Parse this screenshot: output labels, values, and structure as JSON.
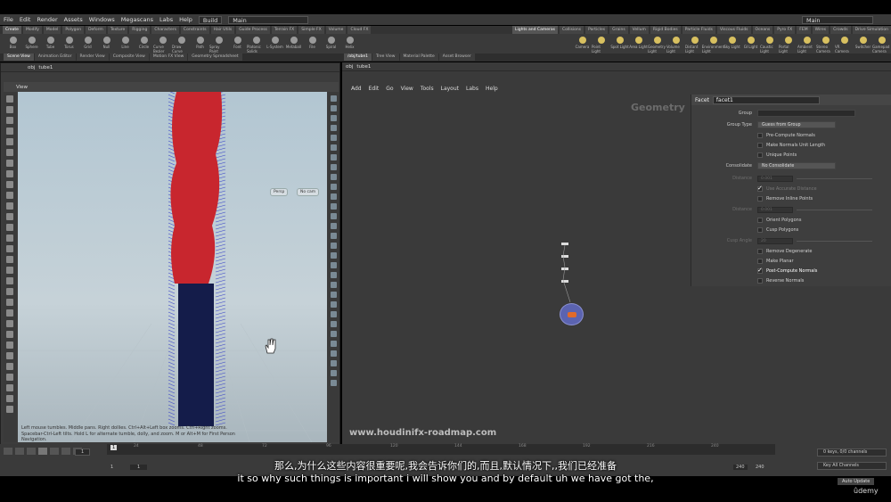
{
  "menubar": {
    "items": [
      "File",
      "Edit",
      "Render",
      "Assets",
      "Windows",
      "Megascans",
      "Labs",
      "Help"
    ],
    "desktop": "Build",
    "context": "Main",
    "right_context": "Main"
  },
  "shelf": {
    "tabs": [
      "Create",
      "Modify",
      "Model",
      "Polygon",
      "Deform",
      "Texture",
      "Rigging",
      "Characters",
      "Constraints",
      "Hair Utils",
      "Guide Process",
      "Terrain FX",
      "Simple FX",
      "Volume",
      "Cloud FX"
    ],
    "tools": [
      "Box",
      "Sphere",
      "Tube",
      "Torus",
      "Grid",
      "Null",
      "Line",
      "Circle",
      "Curve Bezier",
      "Draw Curve",
      "Path",
      "Spray Paint",
      "Font",
      "Platonic Solids",
      "L-System",
      "Metaball",
      "File",
      "Spiral",
      "Helix"
    ],
    "right_tabs": [
      "Lights and Cameras",
      "Collisions",
      "Particles",
      "Grains",
      "Vellum",
      "Rigid Bodies",
      "Particle Fluids",
      "Viscous Fluids",
      "Oceans",
      "Pyro FX",
      "FEM",
      "Wires",
      "Crowds",
      "Drive Simulation"
    ],
    "right_tools": [
      "Camera",
      "Point Light",
      "Spot Light",
      "Area Light",
      "Geometry Light",
      "Volume Light",
      "Distant Light",
      "Environment Light",
      "Sky Light",
      "GI Light",
      "Caustic Light",
      "Portal Light",
      "Ambient Light",
      "Stereo Camera",
      "VR Camera",
      "Switcher",
      "Gamepad Camera"
    ]
  },
  "left_pane": {
    "tabs": [
      "Scene View",
      "Animation Editor",
      "Render View",
      "Composite View",
      "Motion FX View",
      "Geometry Spreadsheet"
    ],
    "path": [
      "obj",
      "tube1"
    ],
    "view_label": "View",
    "persp": "Persp",
    "cam": "No cam",
    "hint": "Left mouse tumbles. Middle pans. Right dollies. Ctrl+Alt+Left box zooms. Ctrl+Right zooms. Spacebar-Ctrl-Left tilts. Hold L for alternate tumble, dolly, and zoom.    M or Alt+M for First Person Navigation."
  },
  "right_pane": {
    "tabs": [
      "/obj/tube1",
      "Tree View",
      "Material Palette",
      "Asset Browser"
    ],
    "path": [
      "obj",
      "tube1"
    ],
    "menu": [
      "Add",
      "Edit",
      "Go",
      "View",
      "Tools",
      "Layout",
      "Labs",
      "Help"
    ],
    "context_label": "Geometry",
    "watermark": "www.houdinifx-roadmap.com"
  },
  "params": {
    "node_type": "Facet",
    "node_name": "facet1",
    "group_label": "Group",
    "group_type_label": "Group Type",
    "group_type": "Guess from Group",
    "pre_compute": "Pre-Compute Normals",
    "make_unit": "Make Normals Unit Length",
    "unique": "Unique Points",
    "consolidate_label": "Consolidate",
    "consolidate": "No Consolidate",
    "distance_label": "Distance",
    "distance_val": "0.001",
    "accurate": "Use Accurate Distance",
    "remove_inline": "Remove Inline Points",
    "distance2_label": "Distance",
    "distance2_val": "0.001",
    "orient": "Orient Polygons",
    "cusp_polys": "Cusp Polygons",
    "cusp_angle_label": "Cusp Angle",
    "cusp_angle_val": "20",
    "remove_degen": "Remove Degenerate",
    "make_planar": "Make Planar",
    "post_compute": "Post-Compute Normals",
    "reverse": "Reverse Normals"
  },
  "timeline": {
    "ticks": [
      "1",
      "24",
      "48",
      "72",
      "96",
      "120",
      "144",
      "168",
      "192",
      "216",
      "240"
    ],
    "frame": "1",
    "start": "1",
    "start2": "1",
    "end": "240",
    "end2": "240",
    "keys": "0 keys, 0/0 channels",
    "key_all": "Key All Channels",
    "auto_update": "Auto Update"
  },
  "subtitles": {
    "zh": "那么,为什么这些内容很重要呢,我会告诉你们的,而且,默认情况下,,我们已经准备",
    "en": "it so why such things is important i will show you and by default uh we have got the,"
  },
  "brand": "ûdemy"
}
